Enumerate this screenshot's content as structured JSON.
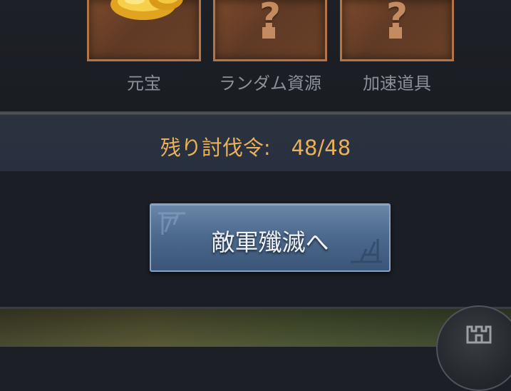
{
  "rewards": [
    {
      "label": "元宝",
      "icon": "gold-ingot-icon"
    },
    {
      "label": "ランダム資源",
      "icon": "question-mark-icon",
      "glyph": "?"
    },
    {
      "label": "加速道具",
      "icon": "question-mark-icon",
      "glyph": "?"
    }
  ],
  "stamina": {
    "text": "残り討伐令:　48/48",
    "current": 48,
    "max": 48
  },
  "action_button": {
    "label": "敵軍殲滅へ"
  },
  "colors": {
    "stamina_text": "#e9b15a",
    "slot_border": "#b37548",
    "button_blue": "#4d6a8f",
    "label_gray": "#8b9099"
  }
}
